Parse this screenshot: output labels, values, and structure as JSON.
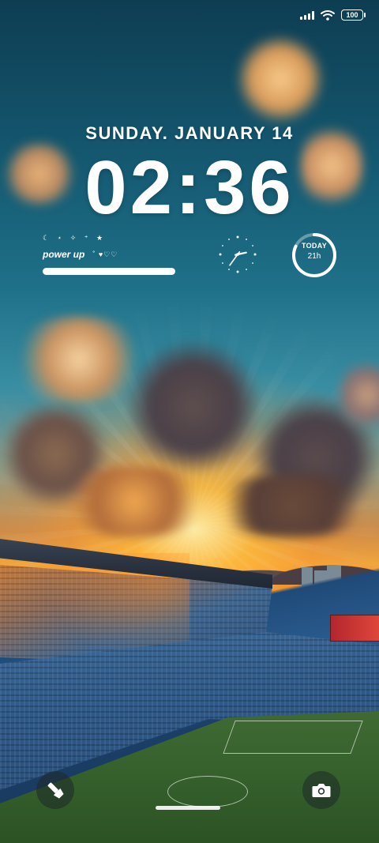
{
  "status_bar": {
    "signal_icon": "signal-bars-icon",
    "wifi_icon": "wifi-icon",
    "battery_level": "100"
  },
  "lock_screen": {
    "date": "SUNDAY.  JANUARY 14",
    "time": "02:36"
  },
  "widgets": {
    "mood": {
      "stars": "☾ ⋆ ✧ ⁺ ★",
      "text": "power up",
      "hearts": "˚ ♥♡♡"
    },
    "analog_clock": {
      "hour": 2,
      "minute": 36
    },
    "today": {
      "label": "TODAY",
      "value": "21h",
      "progress": 0.82
    }
  },
  "quick_actions": {
    "left_icon": "flashlight-icon",
    "right_icon": "camera-icon"
  },
  "colors": {
    "text": "#ffffff",
    "sky_top": "#0e3d52",
    "sunset": "#f2a43a",
    "pitch": "#35602c"
  }
}
